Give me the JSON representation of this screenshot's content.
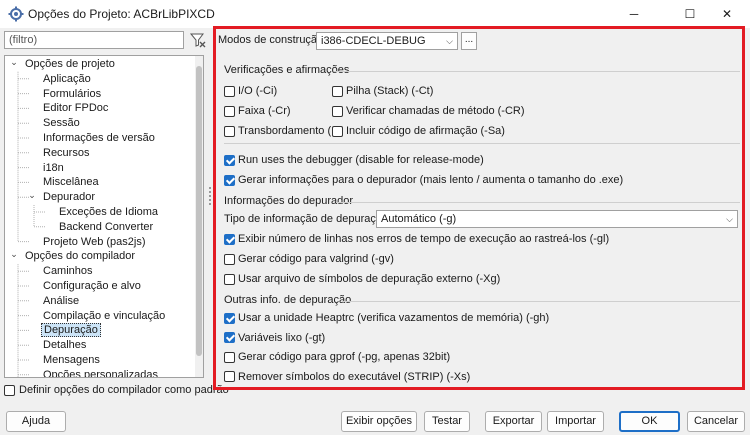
{
  "window": {
    "title": "Opções do Projeto: ACBrLibPIXCD",
    "minimize_glyph": "─",
    "maximize_glyph": "☐",
    "close_glyph": "✕"
  },
  "filter": {
    "placeholder": "(filtro)",
    "icon": "filter-clear-icon"
  },
  "tree": [
    {
      "label": "Opções de projeto",
      "level": 0,
      "expanded": true
    },
    {
      "label": "Aplicação",
      "level": 1
    },
    {
      "label": "Formulários",
      "level": 1
    },
    {
      "label": "Editor FPDoc",
      "level": 1
    },
    {
      "label": "Sessão",
      "level": 1
    },
    {
      "label": "Informações de versão",
      "level": 1
    },
    {
      "label": "Recursos",
      "level": 1
    },
    {
      "label": "i18n",
      "level": 1
    },
    {
      "label": "Miscelânea",
      "level": 1
    },
    {
      "label": "Depurador",
      "level": 1,
      "expanded": true
    },
    {
      "label": "Exceções de Idioma",
      "level": 2
    },
    {
      "label": "Backend Converter",
      "level": 2
    },
    {
      "label": "Projeto Web (pas2js)",
      "level": 1
    },
    {
      "label": "Opções do compilador",
      "level": 0,
      "expanded": true
    },
    {
      "label": "Caminhos",
      "level": 1
    },
    {
      "label": "Configuração e alvo",
      "level": 1
    },
    {
      "label": "Análise",
      "level": 1
    },
    {
      "label": "Compilação e vinculação",
      "level": 1
    },
    {
      "label": "Depuração",
      "level": 1,
      "selected": true
    },
    {
      "label": "Detalhes",
      "level": 1
    },
    {
      "label": "Mensagens",
      "level": 1
    },
    {
      "label": "Opções personalizadas",
      "level": 1
    }
  ],
  "bottom_checkbox": {
    "label": "Definir opções do compilador como padrão",
    "checked": false
  },
  "build_mode": {
    "label": "Modos de construção",
    "value": "i386-CDECL-DEBUG",
    "more_button": "..."
  },
  "checks_group": {
    "title": "Verificações e afirmações",
    "items": [
      {
        "label": "I/O (-Ci)",
        "checked": false
      },
      {
        "label": "Pilha (Stack) (-Ct)",
        "checked": false
      },
      {
        "label": "Faixa (-Cr)",
        "checked": false
      },
      {
        "label": "Verificar chamadas de método (-CR)",
        "checked": false
      },
      {
        "label": "Transbordamento (Ov",
        "checked": false
      },
      {
        "label": "Incluir código de afirmação (-Sa)",
        "checked": false
      }
    ]
  },
  "run_debugger": {
    "label": "Run uses the debugger (disable for release-mode)",
    "checked": true
  },
  "gen_debug_info": {
    "label": "Gerar informações para o depurador (mais lento / aumenta o tamanho do .exe)",
    "checked": true
  },
  "debugger_info": {
    "title": "Informações do depurador",
    "type_label": "Tipo de informação de depuração",
    "type_value": "Automático (-g)",
    "items": [
      {
        "label": "Exibir número de linhas nos erros de tempo de execução ao rastreá-los (-gl)",
        "checked": true
      },
      {
        "label": "Gerar código para valgrind (-gv)",
        "checked": false
      },
      {
        "label": "Usar arquivo de símbolos de depuração externo (-Xg)",
        "checked": false
      }
    ]
  },
  "other_debug": {
    "title": "Outras info. de depuração",
    "items": [
      {
        "label": "Usar a unidade Heaptrc (verifica vazamentos de memória) (-gh)",
        "checked": true
      },
      {
        "label": "Variáveis lixo (-gt)",
        "checked": true
      },
      {
        "label": "Gerar código para gprof (-pg, apenas 32bit)",
        "checked": false
      },
      {
        "label": "Remover símbolos do executável (STRIP) (-Xs)",
        "checked": false
      }
    ]
  },
  "buttons": {
    "help": "Ajuda",
    "show_options": "Exibir opções",
    "test": "Testar",
    "export": "Exportar",
    "import": "Importar",
    "ok": "OK",
    "cancel": "Cancelar"
  },
  "colors": {
    "highlight_frame": "#e31b23",
    "accent": "#1e6fc7"
  }
}
